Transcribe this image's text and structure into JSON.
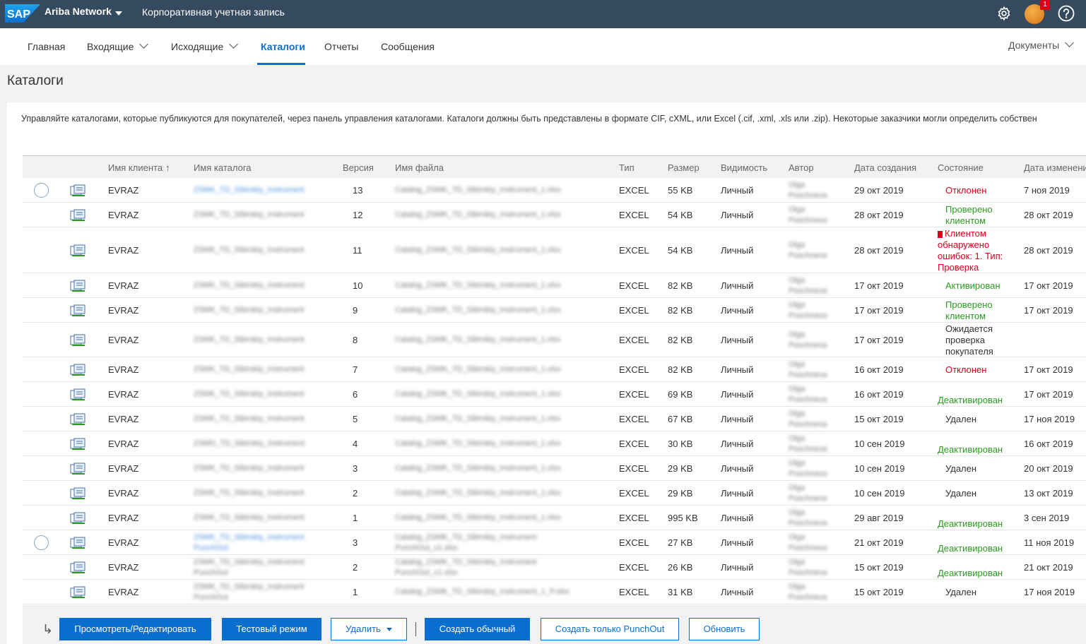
{
  "topbar": {
    "logo": "SAP",
    "brand": "Ariba Network",
    "account": "Корпоративная учетная запись",
    "notifications": "1",
    "icons": [
      "settings-gear-icon",
      "user-avatar",
      "help-icon"
    ]
  },
  "nav": {
    "items": [
      {
        "label": "Главная"
      },
      {
        "label": "Входящие"
      },
      {
        "label": "Исходящие"
      },
      {
        "label": "Каталоги"
      },
      {
        "label": "Отчеты"
      },
      {
        "label": "Сообщения"
      }
    ],
    "documents": "Документы"
  },
  "page": {
    "title": "Каталоги",
    "description": "Управляйте каталогами, которые публикуются для покупателей, через панель управления каталогами. Каталоги должны быть представлены в формате CIF, cXML, или Excel (.cif, .xml, .xls или .zip). Некоторые заказчики могли определить собствен"
  },
  "table": {
    "headers": {
      "client": "Имя клиента",
      "catalog": "Имя каталога",
      "version": "Версия",
      "file": "Имя файла",
      "type": "Тип",
      "size": "Размер",
      "visibility": "Видимость",
      "author": "Автор",
      "created": "Дата создания",
      "status": "Состояние",
      "modified": "Дата изменени"
    },
    "rows": [
      {
        "client": "EVRAZ",
        "catalog": "ZSMK_TD_Sibirskiy_Instrument",
        "version": "13",
        "file": "Catalog_ZSMK_TD_Sibirskiy_Instrument_1.xlsx",
        "type": "EXCEL",
        "size": "55 KB",
        "visibility": "Личный",
        "author": "Olga Poschneva",
        "created": "29 окт 2019",
        "status": "Отклонен",
        "status_kind": "red",
        "modified": "7 ноя 2019"
      },
      {
        "client": "EVRAZ",
        "catalog": "ZSMK_TD_Sibirskiy_Instrument",
        "version": "12",
        "file": "Catalog_ZSMK_TD_Sibirskiy_Instrument_1.xlsx",
        "type": "EXCEL",
        "size": "54 KB",
        "visibility": "Личный",
        "author": "Olga Poschneva",
        "created": "28 окт 2019",
        "status": "Проверено клиентом",
        "status_kind": "green",
        "modified": "28 окт 2019"
      },
      {
        "client": "EVRAZ",
        "catalog": "ZSMK_TD_Sibirskiy_Instrument",
        "version": "11",
        "file": "Catalog_ZSMK_TD_Sibirskiy_Instrument_1.xlsx",
        "type": "EXCEL",
        "size": "54 KB",
        "visibility": "Личный",
        "author": "Olga Poschneva",
        "created": "28 окт 2019",
        "status": "Клиентом обнаружено ошибок: 1. Тип: Проверка",
        "status_kind": "error",
        "modified": "28 окт 2019"
      },
      {
        "client": "EVRAZ",
        "catalog": "ZSMK_TD_Sibirskiy_Instrument",
        "version": "10",
        "file": "Catalog_ZSMK_TD_Sibirskiy_Instrument_1.xlsx",
        "type": "EXCEL",
        "size": "82 KB",
        "visibility": "Личный",
        "author": "Olga Poschneva",
        "created": "17 окт 2019",
        "status": "Активирован",
        "status_kind": "green",
        "modified": "17 окт 2019"
      },
      {
        "client": "EVRAZ",
        "catalog": "ZSMK_TD_Sibirskiy_Instrument",
        "version": "9",
        "file": "Catalog_ZSMK_TD_Sibirskiy_Instrument_1.xlsx",
        "type": "EXCEL",
        "size": "82 KB",
        "visibility": "Личный",
        "author": "Olga Poschneva",
        "created": "17 окт 2019",
        "status": "Проверено клиентом",
        "status_kind": "green",
        "modified": "17 окт 2019"
      },
      {
        "client": "EVRAZ",
        "catalog": "ZSMK_TD_Sibirskiy_Instrument",
        "version": "8",
        "file": "Catalog_ZSMK_TD_Sibirskiy_Instrument_1.xlsx",
        "type": "EXCEL",
        "size": "82 KB",
        "visibility": "Личный",
        "author": "Olga Poschneva",
        "created": "17 окт 2019",
        "status": "Ожидается проверка покупателя",
        "status_kind": "dark",
        "modified": ""
      },
      {
        "client": "EVRAZ",
        "catalog": "ZSMK_TD_Sibirskiy_Instrument",
        "version": "7",
        "file": "Catalog_ZSMK_TD_Sibirskiy_Instrument_1.xlsx",
        "type": "EXCEL",
        "size": "82 KB",
        "visibility": "Личный",
        "author": "Olga Poschneva",
        "created": "16 окт 2019",
        "status": "Отклонен",
        "status_kind": "red",
        "modified": "17 окт 2019"
      },
      {
        "client": "EVRAZ",
        "catalog": "ZSMK_TD_Sibirskiy_Instrument",
        "version": "6",
        "file": "Catalog_ZSMK_TD_Sibirskiy_Instrument_1.xlsx",
        "type": "EXCEL",
        "size": "69 KB",
        "visibility": "Личный",
        "author": "Olga Poschneva",
        "created": "16 окт 2019",
        "status": "Деактивирован",
        "status_kind": "green",
        "modified": "17 окт 2019"
      },
      {
        "client": "EVRAZ",
        "catalog": "ZSMK_TD_Sibirskiy_Instrument",
        "version": "5",
        "file": "Catalog_ZSMK_TD_Sibirskiy_Instrument_1.xlsx",
        "type": "EXCEL",
        "size": "67 KB",
        "visibility": "Личный",
        "author": "Olga Poschneva",
        "created": "15 окт 2019",
        "status": "Удален",
        "status_kind": "dark",
        "modified": "17 ноя 2019"
      },
      {
        "client": "EVRAZ",
        "catalog": "ZSMD_TD_Sibirskiy_Instrument",
        "version": "4",
        "file": "Catalog_ZSMK_TD_Sibirskiy_Instrument_1.xlsx",
        "type": "EXCEL",
        "size": "30 KB",
        "visibility": "Личный",
        "author": "Olga Poschneva",
        "created": "10 сен 2019",
        "status": "Деактивирован",
        "status_kind": "green",
        "modified": "16 окт 2019"
      },
      {
        "client": "EVRAZ",
        "catalog": "ZSMK_TD_Sibirskiy_Instrument",
        "version": "3",
        "file": "Catalog_ZSMK_TD_Sibirskiy_Instrument_1.xlsx",
        "type": "EXCEL",
        "size": "29 KB",
        "visibility": "Личный",
        "author": "Olga Poschneva",
        "created": "10 сен 2019",
        "status": "Удален",
        "status_kind": "dark",
        "modified": "20 окт 2019"
      },
      {
        "client": "EVRAZ",
        "catalog": "ZSMK_TD_Sibirskiy_Instrument",
        "version": "2",
        "file": "Catalog_ZSMK_TD_Sibirskiy_Instrument_1.xlsx",
        "type": "EXCEL",
        "size": "29 KB",
        "visibility": "Личный",
        "author": "Olga Poschneva",
        "created": "10 сен 2019",
        "status": "Удален",
        "status_kind": "dark",
        "modified": "13 окт 2019"
      },
      {
        "client": "EVRAZ",
        "catalog": "ZSMK_TD_Sibirskiy_Instrument",
        "version": "1",
        "file": "Catalog_ZSMK_TD_Sibirskiy_Instrument_1.xlsx",
        "type": "EXCEL",
        "size": "995 KB",
        "visibility": "Личный",
        "author": "Olga Poschneva",
        "created": "29 авг 2019",
        "status": "Деактивирован",
        "status_kind": "green",
        "modified": "3 сен 2019"
      },
      {
        "client": "EVRAZ",
        "catalog": "ZSMK_TD_Sibirskiy_Instrument PunchOut",
        "version": "3",
        "file": "Catalog_ZSMK_TD_Sibirskiy_Instrument PunchOut_v1.xlsx",
        "type": "EXCEL",
        "size": "27 KB",
        "visibility": "Личный",
        "author": "Olga Poschneva",
        "created": "21 окт 2019",
        "status": "Деактивирован",
        "status_kind": "green",
        "modified": "11 ноя 2019"
      },
      {
        "client": "EVRAZ",
        "catalog": "ZSMK_TD_Sibirskiy_Instrument PunchOut",
        "version": "2",
        "file": "Catalog_ZSMK_TD_Sibirskiy_Instrument PunchOut_v1.xlsx",
        "type": "EXCEL",
        "size": "26 KB",
        "visibility": "Личный",
        "author": "Olga Poschneva",
        "created": "15 окт 2019",
        "status": "Деактивирован",
        "status_kind": "green",
        "modified": "21 окт 2019"
      },
      {
        "client": "EVRAZ",
        "catalog": "ZSMK_TD_Sibirskiy_Instrument PunchOut",
        "version": "1",
        "file": "Catalog_ZSMK_TD_Sibirskiy_Instrument_1_P.xlsx",
        "type": "EXCEL",
        "size": "31 KB",
        "visibility": "Личный",
        "author": "Olga Poschneva",
        "created": "15 окт 2019",
        "status": "Удален",
        "status_kind": "dark",
        "modified": "17 ноя 2019"
      }
    ]
  },
  "footer": {
    "view_edit": "Просмотреть/Редактировать",
    "test_mode": "Тестовый режим",
    "delete": "Удалить",
    "create_regular": "Создать обычный",
    "create_punchout": "Создать только PunchOut",
    "refresh": "Обновить"
  },
  "colors": {
    "topbar": "#354a5f",
    "accent": "#0a6ed1",
    "status_red": "#d9001b",
    "status_green": "#2b9b1f"
  }
}
